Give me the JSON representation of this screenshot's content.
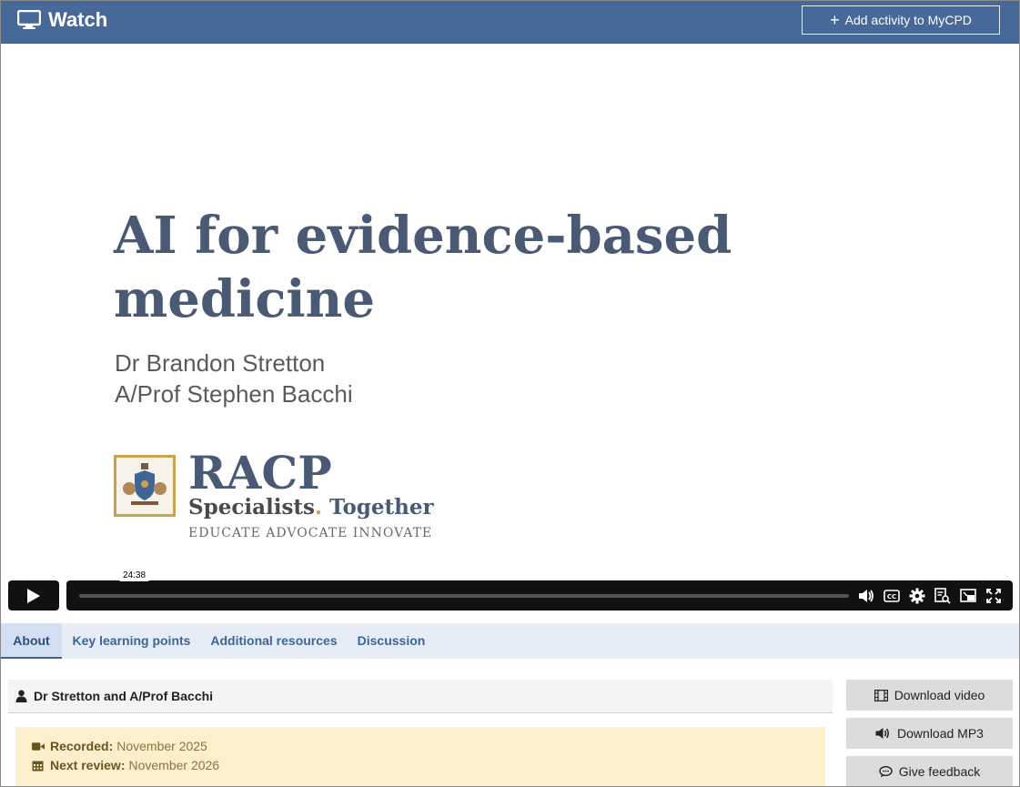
{
  "header": {
    "title": "Watch",
    "add_button_label": "Add activity to MyCPD"
  },
  "slide": {
    "title_line1": "AI for evidence-based",
    "title_line2": "medicine",
    "author1": "Dr Brandon Stretton",
    "author2": "A/Prof Stephen Bacchi",
    "logo_name": "RACP",
    "logo_tag1": "Specialists",
    "logo_dot": ".",
    "logo_tag2": " Together",
    "logo_sub": "EDUCATE  ADVOCATE  INNOVATE"
  },
  "player": {
    "duration": "24:38",
    "progress": 0.0
  },
  "tabs": [
    {
      "label": "About",
      "active": true
    },
    {
      "label": "Key learning points",
      "active": false
    },
    {
      "label": "Additional resources",
      "active": false
    },
    {
      "label": "Discussion",
      "active": false
    }
  ],
  "presenter": {
    "name": "Dr Stretton and A/Prof Bacchi"
  },
  "info": {
    "recorded_label": "Recorded:",
    "recorded_value": "November 2025",
    "review_label": "Next review:",
    "review_value": "November 2026"
  },
  "side_buttons": {
    "download_video": "Download video",
    "download_mp3": "Download MP3",
    "give_feedback": "Give feedback"
  },
  "colors": {
    "header": "#46699a",
    "tab_bar": "#e6edf7",
    "notice": "#fcf0cc",
    "slide_title": "#4a5a75",
    "gold": "#c9a24d"
  }
}
